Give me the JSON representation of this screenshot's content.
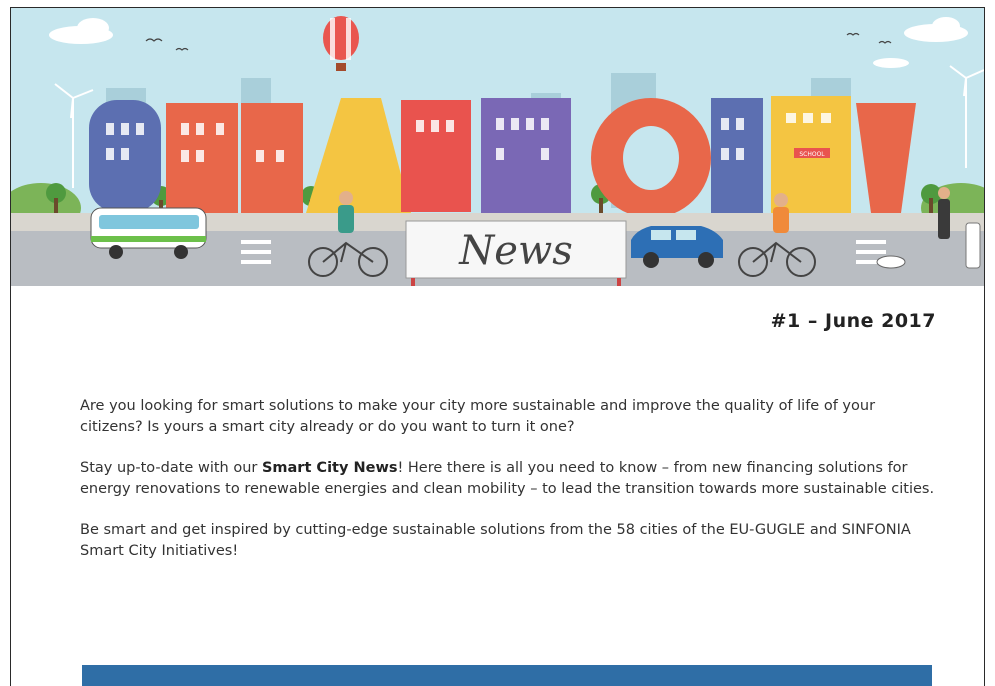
{
  "banner": {
    "sign_text": "News",
    "school_sign": "SCHOOL"
  },
  "issue": {
    "label": "#1 – June 2017"
  },
  "intro": {
    "paragraph1": "Are you looking for smart solutions to make your city more sustainable and improve the quality of life of your citizens? Is yours a smart city already or do you want to turn it one?",
    "paragraph2_before": "Stay up-to-date with our ",
    "paragraph2_bold": "Smart City News",
    "paragraph2_after": "! Here there is all you need to know – from new financing solutions for energy renovations to renewable energies and clean mobility – to lead the transition towards more sustainable cities.",
    "paragraph3": "Be smart and get inspired by cutting-edge sustainable solutions from the 58 cities of the EU-GUGLE and SINFONIA Smart City Initiatives!"
  },
  "colors": {
    "sky": "#bfe3ec",
    "road": "#b9bdc2",
    "accent_blue": "#2f6ea6"
  }
}
